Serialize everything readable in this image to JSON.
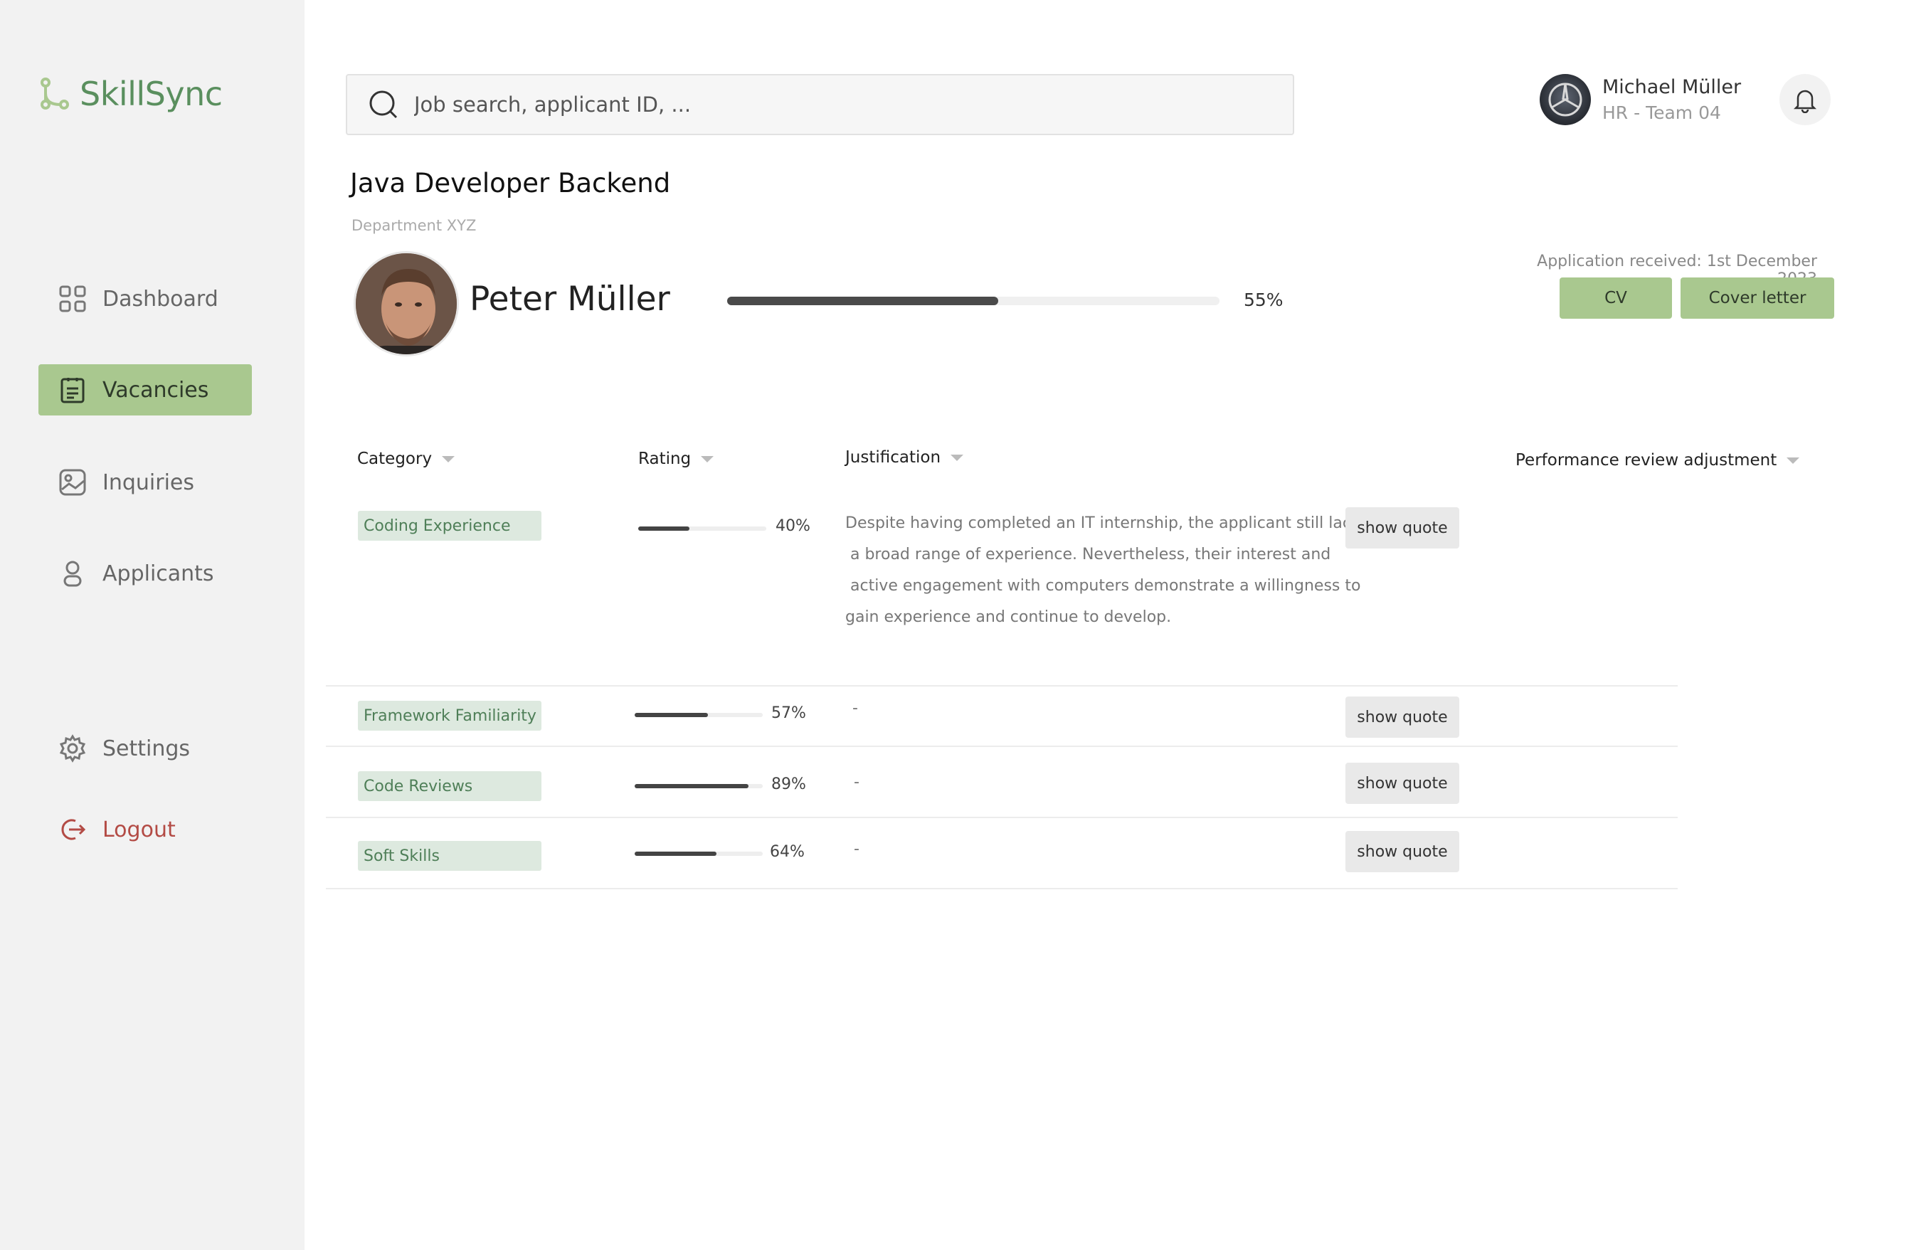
{
  "app": {
    "name": "SkillSync"
  },
  "sidebar": {
    "items": [
      {
        "label": "Dashboard",
        "icon": "grid-icon",
        "active": false
      },
      {
        "label": "Vacancies",
        "icon": "clipboard-icon",
        "active": true
      },
      {
        "label": "Inquiries",
        "icon": "image-icon",
        "active": false
      },
      {
        "label": "Applicants",
        "icon": "user-icon",
        "active": false
      }
    ],
    "settings_label": "Settings",
    "logout_label": "Logout"
  },
  "search": {
    "placeholder": "Job search, applicant ID, ..."
  },
  "user": {
    "name": "Michael Müller",
    "role": "HR - Team 04"
  },
  "vacancy": {
    "title": "Java Developer Backend",
    "department": "Department XYZ"
  },
  "applicant": {
    "name": "Peter Müller",
    "match_percent": 55,
    "match_label": "55%",
    "received": "Application received: 1st December 2023",
    "cv_label": "CV",
    "cover_letter_label": "Cover letter"
  },
  "table": {
    "headers": {
      "category": "Category",
      "rating": "Rating",
      "justification": "Justification",
      "adjustment": "Performance review adjustment"
    },
    "quote_label": "show quote",
    "rows": [
      {
        "category": "Coding Experience",
        "rating": 40,
        "rating_label": "40%",
        "justification": [
          "Despite having completed an IT internship, the applicant still lacks",
          " a broad range of experience. Nevertheless, their interest and",
          " active engagement with computers demonstrate a willingness to",
          "gain experience and continue to develop."
        ]
      },
      {
        "category": "Framework Familiarity",
        "rating": 57,
        "rating_label": "57%",
        "justification": [
          "-"
        ]
      },
      {
        "category": "Code Reviews",
        "rating": 89,
        "rating_label": "89%",
        "justification": [
          "-"
        ]
      },
      {
        "category": "Soft Skills",
        "rating": 64,
        "rating_label": "64%",
        "justification": [
          "-"
        ]
      }
    ]
  },
  "colors": {
    "brand": "#5a8f5e",
    "active_nav": "#a9c88f",
    "tag_bg": "#dde9df",
    "logout": "#b34b45"
  }
}
